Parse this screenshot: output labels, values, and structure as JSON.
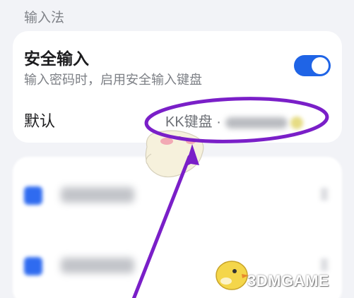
{
  "section": {
    "title": "输入法"
  },
  "secure_input": {
    "title": "安全输入",
    "subtitle": "输入密码时，启用安全输入键盘",
    "toggle_on": true
  },
  "default_keyboard": {
    "label": "默认",
    "value": "KK键盘 ·"
  },
  "watermark": {
    "text": "3DMGAME"
  },
  "colors": {
    "accent": "#1f64e6",
    "annotation": "#7a1fc8",
    "background": "#f2f3f7"
  }
}
